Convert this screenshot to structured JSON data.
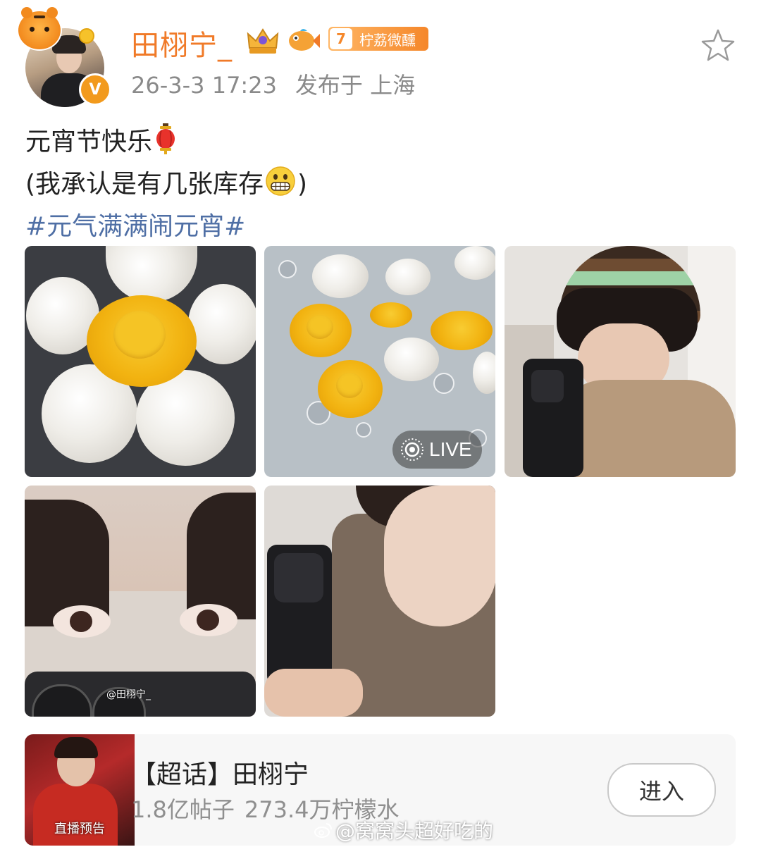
{
  "post": {
    "author": {
      "name": "田栩宁_",
      "level_number": "7",
      "fan_badge_label": "柠荔微醺",
      "verified_mark": "V"
    },
    "timestamp": "26-3-3 17:23",
    "location": "发布于 上海",
    "text_lines": [
      "元宵节快乐",
      "(我承认是有几张库存",
      ")"
    ],
    "hashtag": "#元气满满闹元宵#",
    "images": [
      {
        "live": false
      },
      {
        "live": true,
        "live_label": "LIVE"
      },
      {
        "live": false
      },
      {
        "live": false,
        "watermark": "@田栩宁_"
      },
      {
        "live": false
      }
    ]
  },
  "supertopic": {
    "title": "【超话】田栩宁",
    "posts": "1.8亿帖子",
    "followers": "273.4万柠檬水",
    "thumb_caption": "直播预告",
    "enter_label": "进入"
  },
  "watermark": "@窝窝头超好吃的",
  "icons": {
    "favorite": "star-outline-icon",
    "lantern": "red-lantern-emoji",
    "grimace": "grimacing-face-emoji",
    "live": "live-photo-icon"
  },
  "colors": {
    "username": "#f07a28",
    "hashtag": "#4f6fa5",
    "meta": "#8a8a8a",
    "badge": "#f5872a"
  }
}
